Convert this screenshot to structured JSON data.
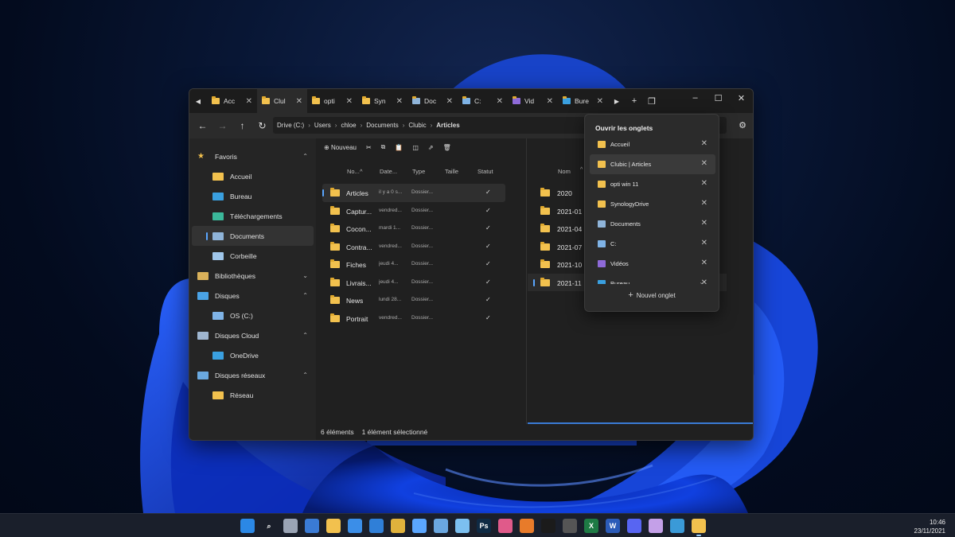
{
  "tabs": [
    {
      "label": "Acc",
      "icon": "home-icon",
      "active": false
    },
    {
      "label": "Clul",
      "icon": "folder-icon",
      "active": true
    },
    {
      "label": "opti",
      "icon": "folder-icon",
      "active": false
    },
    {
      "label": "Syn",
      "icon": "folder-icon",
      "active": false
    },
    {
      "label": "Doc",
      "icon": "documents-icon",
      "active": false
    },
    {
      "label": "C:",
      "icon": "drive-icon",
      "active": false
    },
    {
      "label": "Vid",
      "icon": "videos-icon",
      "active": false
    },
    {
      "label": "Bure",
      "icon": "desktop-icon",
      "active": false
    }
  ],
  "breadcrumb": [
    "Drive (C:)",
    "Users",
    "chloe",
    "Documents",
    "Clubic",
    "Articles"
  ],
  "sidebar": [
    {
      "label": "Favoris",
      "icon": "star-icon",
      "header": true,
      "chevron": "^"
    },
    {
      "label": "Accueil",
      "icon": "home-icon"
    },
    {
      "label": "Bureau",
      "icon": "desktop-icon"
    },
    {
      "label": "Téléchargements",
      "icon": "downloads-icon"
    },
    {
      "label": "Documents",
      "icon": "documents-icon",
      "selected": true
    },
    {
      "label": "Corbeille",
      "icon": "recycle-bin-icon"
    },
    {
      "label": "Bibliothèques",
      "icon": "library-icon",
      "header": true,
      "chevron": "v"
    },
    {
      "label": "Disques",
      "icon": "monitor-icon",
      "header": true,
      "chevron": "^"
    },
    {
      "label": "OS (C:)",
      "icon": "drive-icon"
    },
    {
      "label": "Disques Cloud",
      "icon": "cloud-drive-icon",
      "header": true,
      "chevron": "^"
    },
    {
      "label": "OneDrive",
      "icon": "onedrive-icon"
    },
    {
      "label": "Disques réseaux",
      "icon": "network-icon",
      "header": true,
      "chevron": "^"
    },
    {
      "label": "Réseau",
      "icon": "folder-icon"
    }
  ],
  "toolbar": {
    "new_label": "Nouveau"
  },
  "columns": {
    "name": "No...",
    "date": "Date...",
    "type": "Type",
    "size": "Taille",
    "status": "Statut"
  },
  "files": [
    {
      "name": "Articles",
      "date": "il y a 0 s...",
      "type": "Dossier...",
      "selected": true
    },
    {
      "name": "Captur...",
      "date": "vendred...",
      "type": "Dossier..."
    },
    {
      "name": "Cocon...",
      "date": "mardi 1...",
      "type": "Dossier..."
    },
    {
      "name": "Contra...",
      "date": "vendred...",
      "type": "Dossier..."
    },
    {
      "name": "Fiches",
      "date": "jeudi 4...",
      "type": "Dossier..."
    },
    {
      "name": "Livrais...",
      "date": "jeudi 4...",
      "type": "Dossier..."
    },
    {
      "name": "News",
      "date": "lundi 28...",
      "type": "Dossier..."
    },
    {
      "name": "Portrait",
      "date": "vendred...",
      "type": "Dossier..."
    }
  ],
  "pane2": {
    "col_name": "Nom",
    "folders": [
      {
        "name": "2020"
      },
      {
        "name": "2021-01"
      },
      {
        "name": "2021-04"
      },
      {
        "name": "2021-07"
      },
      {
        "name": "2021-10"
      },
      {
        "name": "2021-11",
        "selected": true
      }
    ]
  },
  "status": {
    "count": "6 éléments",
    "selection": "1 élément sélectionné"
  },
  "dropdown": {
    "title": "Ouvrir les onglets",
    "items": [
      {
        "label": "Accueil",
        "icon": "home-icon",
        "color": "#f2c14e"
      },
      {
        "label": "Clubic | Articles",
        "icon": "folder-icon",
        "color": "#f2c14e",
        "active": true
      },
      {
        "label": "opti win 11",
        "icon": "folder-icon",
        "color": "#f2c14e"
      },
      {
        "label": "SynologyDrive",
        "icon": "folder-icon",
        "color": "#f2c14e"
      },
      {
        "label": "Documents",
        "icon": "documents-icon",
        "color": "#8fb4d9"
      },
      {
        "label": "C:",
        "icon": "drive-icon",
        "color": "#7fb3e6"
      },
      {
        "label": "Vidéos",
        "icon": "videos-icon",
        "color": "#8e6ad8"
      },
      {
        "label": "Bureau",
        "icon": "desktop-icon",
        "color": "#3aa0e0"
      }
    ],
    "new_tab": "Nouvel onglet"
  },
  "taskbar": {
    "apps": [
      {
        "name": "start-icon",
        "glyph": "",
        "color": "#2b88e6"
      },
      {
        "name": "search-icon",
        "glyph": "⌕",
        "color": "transparent"
      },
      {
        "name": "task-view-icon",
        "glyph": "",
        "color": "#9aa4b5"
      },
      {
        "name": "widgets-icon",
        "glyph": "",
        "color": "#3a7bd5"
      },
      {
        "name": "file-explorer-icon",
        "glyph": "",
        "color": "#f2c14e"
      },
      {
        "name": "store-icon",
        "glyph": "",
        "color": "#3b8ee8"
      },
      {
        "name": "mail-icon",
        "glyph": "",
        "color": "#2f7fd8"
      },
      {
        "name": "chrome-icon",
        "glyph": "",
        "color": "#e0b23c"
      },
      {
        "name": "remote-desktop-icon",
        "glyph": "",
        "color": "#5aa6ff"
      },
      {
        "name": "notepad-icon",
        "glyph": "",
        "color": "#6aa7e0"
      },
      {
        "name": "photos-icon",
        "glyph": "",
        "color": "#7cc0f0"
      },
      {
        "name": "photoshop-icon",
        "glyph": "Ps",
        "color": "#0f2a44"
      },
      {
        "name": "color-app-icon",
        "glyph": "",
        "color": "#e05a8a"
      },
      {
        "name": "firefox-icon",
        "glyph": "",
        "color": "#e87b2a"
      },
      {
        "name": "terminal-icon",
        "glyph": "",
        "color": "#1b1b1b"
      },
      {
        "name": "calculator-icon",
        "glyph": "",
        "color": "#555"
      },
      {
        "name": "excel-icon",
        "glyph": "X",
        "color": "#1e7a44"
      },
      {
        "name": "word-icon",
        "glyph": "W",
        "color": "#2b5bb8"
      },
      {
        "name": "discord-icon",
        "glyph": "",
        "color": "#5865f2"
      },
      {
        "name": "snipping-icon",
        "glyph": "",
        "color": "#c4a0e8"
      },
      {
        "name": "image-viewer-icon",
        "glyph": "",
        "color": "#3a9ad8"
      },
      {
        "name": "explorer-plus-icon",
        "glyph": "",
        "color": "#f2c14e",
        "on": true
      }
    ],
    "time": "10:46",
    "date": "23/11/2021"
  }
}
